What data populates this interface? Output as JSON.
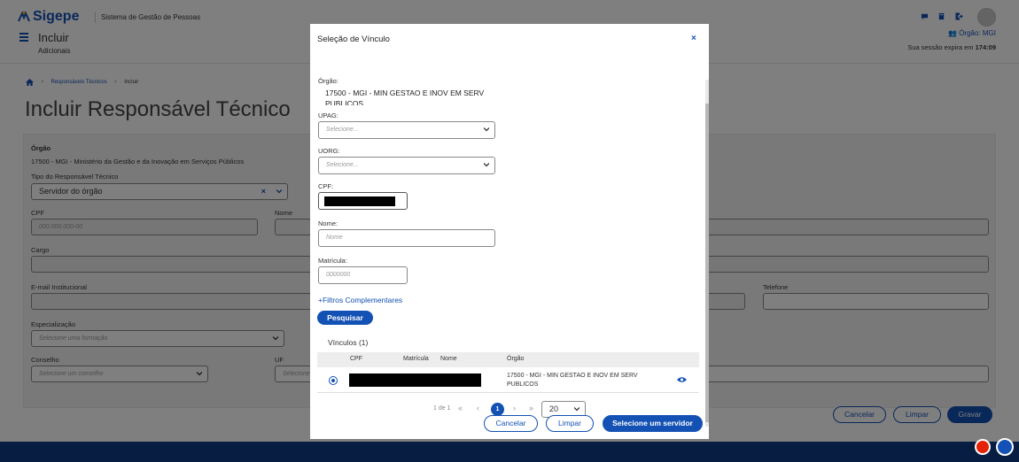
{
  "header": {
    "brand": "Sigepe",
    "system_name": "Sistema de Gestão de Pessoas",
    "title": "Incluir",
    "subtitle": "Adicionais",
    "orgao_link": "Órgão: MGI",
    "session_prefix": "Sua sessão expira em",
    "session_time": "174:09"
  },
  "breadcrumb": [
    "Responsáveis Técnicos",
    "Incluir"
  ],
  "page_title": "Incluir Responsável Técnico",
  "form": {
    "orgao_label": "Órgão",
    "orgao_value": "17500 - MGI - Ministério da Gestão e da Inovação em Serviços Públicos",
    "tipo_label": "Tipo do Responsável Técnico",
    "tipo_value": "Servidor do órgão",
    "cpf_label": "CPF",
    "cpf_placeholder": "000.000.000-00",
    "nome_label": "Nome",
    "cargo_label": "Cargo",
    "email_label": "E-mail Institucional",
    "telefone_label": "Telefone",
    "especializacao_label": "Especialização",
    "especializacao_placeholder": "Selecione uma formação",
    "conselho_label": "Conselho",
    "conselho_placeholder": "Selecione um conselho",
    "uf_label": "UF",
    "uf_placeholder": "Selecione",
    "cancel": "Cancelar",
    "clear": "Limpar",
    "save": "Gravar"
  },
  "modal": {
    "title": "Seleção de Vínculo",
    "close": "×",
    "orgao_label": "Órgão:",
    "orgao_value": "17500 - MGI - MIN GESTAO E INOV EM SERV PUBLICOS",
    "upag_label": "UPAG:",
    "upag_placeholder": "Selecione...",
    "uorg_label": "UORG:",
    "uorg_placeholder": "Selecione...",
    "cpf_label": "CPF:",
    "nome_label": "Nome:",
    "nome_placeholder": "Nome",
    "matricula_label": "Matrícula:",
    "matricula_placeholder": "0000000",
    "filtros": "+Filtros Complementares",
    "pesquisar": "Pesquisar",
    "vinculos_title": "Vínculos (1)",
    "table_headers": [
      "CPF",
      "Matrícula",
      "Nome",
      "Órgão"
    ],
    "row_orgao": "17500 - MGI - MIN GESTAO E INOV EM SERV PUBLICOS",
    "pager_info": "1 de 1",
    "page_current": "1",
    "page_size": "20",
    "cancel": "Cancelar",
    "clear": "Limpar",
    "select": "Selecione um servidor"
  }
}
